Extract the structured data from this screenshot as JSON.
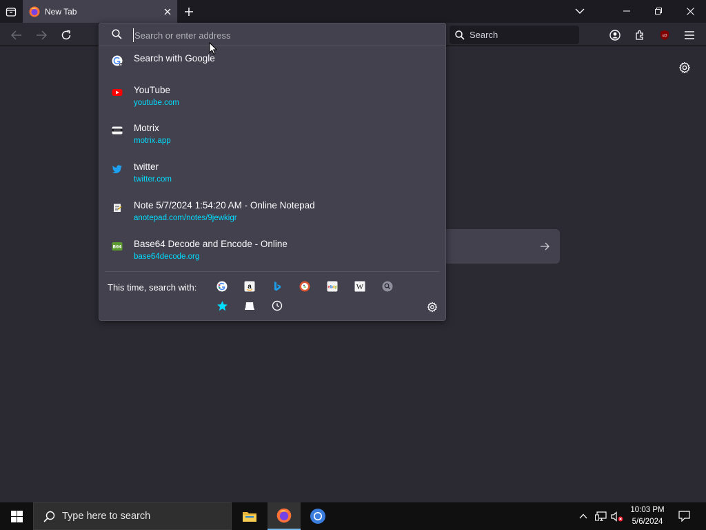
{
  "browser": {
    "tab": {
      "title": "New Tab"
    },
    "searchbar": {
      "label": "Search"
    }
  },
  "urlbar": {
    "placeholder": "Search or enter address",
    "results": [
      {
        "title": "Search with Google",
        "url": "",
        "icon": "google-icon"
      },
      {
        "title": "YouTube",
        "url": "youtube.com",
        "icon": "youtube-icon"
      },
      {
        "title": "Motrix",
        "url": "motrix.app",
        "icon": "motrix-icon"
      },
      {
        "title": "twitter",
        "url": "twitter.com",
        "icon": "twitter-icon"
      },
      {
        "title": "Note 5/7/2024 1:54:20 AM - Online Notepad",
        "url": "anotepad.com/notes/9jewkigr",
        "icon": "notepad-icon"
      },
      {
        "title": "Base64 Decode and Encode - Online",
        "url": "base64decode.org",
        "icon": "base64-icon"
      }
    ],
    "oneoff_label": "This time, search with:",
    "engines": [
      "google",
      "amazon",
      "bing",
      "duckduckgo",
      "ebay",
      "wikipedia",
      "search-engine"
    ],
    "local_sources": [
      "bookmarks",
      "tabs",
      "history"
    ]
  },
  "taskbar": {
    "search_placeholder": "Type here to search",
    "time": "10:03 PM",
    "date": "5/6/2024"
  },
  "colors": {
    "accent": "#00ddff",
    "background": "#2b2a33",
    "popup": "#42414d"
  }
}
